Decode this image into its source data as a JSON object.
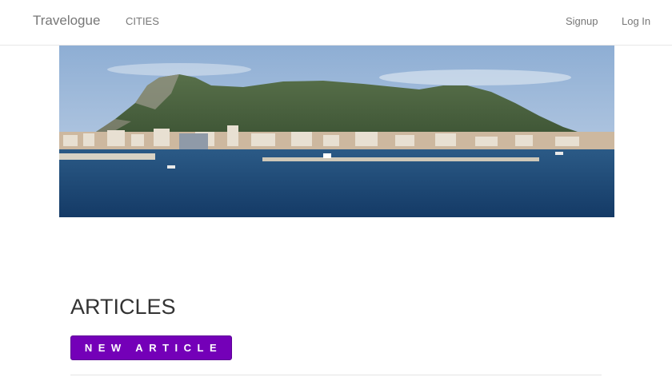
{
  "navbar": {
    "brand": "Travelogue",
    "cities_link": "CITIES",
    "signup_link": "Signup",
    "login_link": "Log In"
  },
  "articles": {
    "title": "ARTICLES",
    "new_article_button": "NEW ARTICLE"
  },
  "colors": {
    "button_bg": "#7400b8",
    "nav_text": "#777777",
    "sky": "#9fb9d6",
    "sea": "#1f4a79"
  },
  "icons": []
}
